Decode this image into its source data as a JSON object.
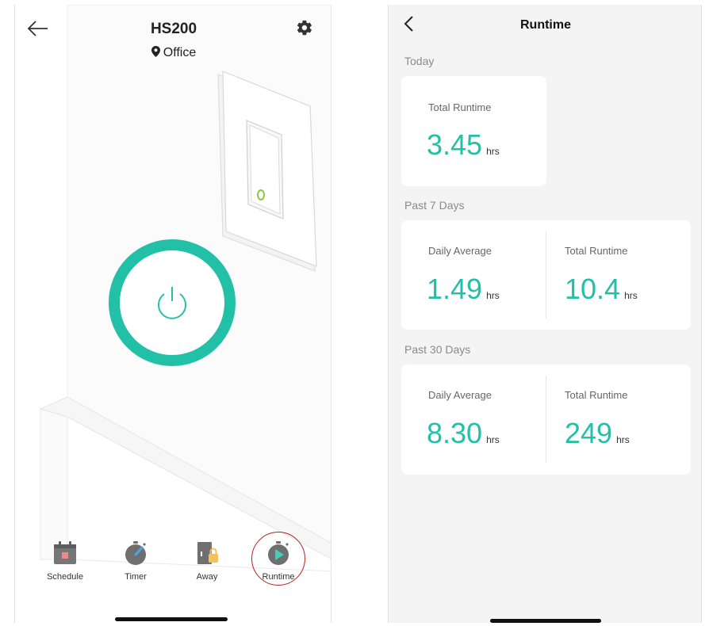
{
  "left_screen": {
    "device_name": "HS200",
    "location": "Office",
    "nav_items": [
      {
        "label": "Schedule",
        "icon": "calendar-icon"
      },
      {
        "label": "Timer",
        "icon": "stopwatch-icon"
      },
      {
        "label": "Away",
        "icon": "away-lock-icon"
      },
      {
        "label": "Runtime",
        "icon": "runtime-play-icon"
      }
    ],
    "accent_color": "#22c0a6",
    "highlight_color": "#b22222"
  },
  "right_screen": {
    "title": "Runtime",
    "sections": [
      {
        "label": "Today",
        "stats": [
          {
            "label": "Total Runtime",
            "value": "3.45",
            "unit": "hrs"
          }
        ]
      },
      {
        "label": "Past 7 Days",
        "stats": [
          {
            "label": "Daily Average",
            "value": "1.49",
            "unit": "hrs"
          },
          {
            "label": "Total Runtime",
            "value": "10.4",
            "unit": "hrs"
          }
        ]
      },
      {
        "label": "Past 30 Days",
        "stats": [
          {
            "label": "Daily Average",
            "value": "8.30",
            "unit": "hrs"
          },
          {
            "label": "Total Runtime",
            "value": "249",
            "unit": "hrs"
          }
        ]
      }
    ],
    "value_color": "#22c0a6"
  }
}
